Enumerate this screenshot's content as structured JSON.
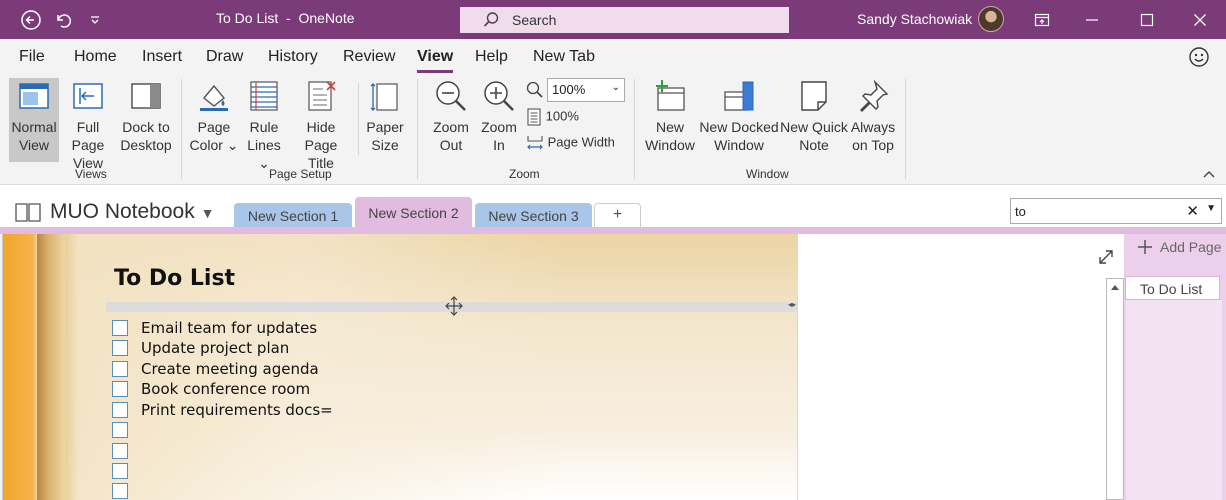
{
  "titlebar": {
    "title": "To Do List",
    "sep": "-",
    "app": "OneNote",
    "search_label": "Search",
    "user": "Sandy Stachowiak"
  },
  "menu": {
    "items": [
      "File",
      "Home",
      "Insert",
      "Draw",
      "History",
      "Review",
      "View",
      "Help",
      "New Tab"
    ],
    "active": "View"
  },
  "ribbon": {
    "views": {
      "normal": [
        "Normal",
        "View"
      ],
      "full_page": [
        "Full Page",
        "View"
      ],
      "dock": [
        "Dock to",
        "Desktop"
      ],
      "label": "Views"
    },
    "page_setup": {
      "page_color": [
        "Page",
        "Color"
      ],
      "rule_lines": [
        "Rule",
        "Lines"
      ],
      "hide_title": [
        "Hide",
        "Page Title"
      ],
      "paper_size": [
        "Paper",
        "Size"
      ],
      "label": "Page Setup"
    },
    "zoom": {
      "zoom_out": [
        "Zoom",
        "Out"
      ],
      "zoom_in": [
        "Zoom",
        "In"
      ],
      "zoom_value": "100%",
      "hundred": "100%",
      "page_width": "Page Width",
      "label": "Zoom"
    },
    "window": {
      "new_window": [
        "New",
        "Window"
      ],
      "new_docked": [
        "New Docked",
        "Window"
      ],
      "quick_note": [
        "New Quick",
        "Note"
      ],
      "always_top": [
        "Always",
        "on Top"
      ],
      "label": "Window"
    }
  },
  "notebook": {
    "name": "MUO Notebook",
    "sections": [
      "New Section 1",
      "New Section 2",
      "New Section 3"
    ],
    "add_tab": "+",
    "find_value": "to"
  },
  "page": {
    "title": "To Do List",
    "items": [
      "Email team for updates",
      "Update project plan",
      "Create meeting agenda",
      "Book conference room",
      "Print requirements docs=",
      "",
      "",
      "",
      ""
    ]
  },
  "pagelist": {
    "add_label": "Add Page",
    "pages": [
      "To Do List"
    ]
  },
  "colors": {
    "accent": "#7b3b79",
    "section_blue": "#a9c6e8",
    "section_pink": "#e2bbe0"
  }
}
